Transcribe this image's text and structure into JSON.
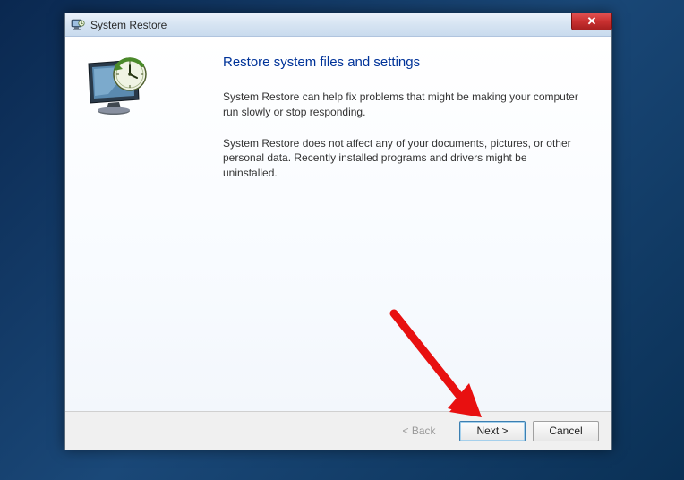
{
  "titlebar": {
    "title": "System Restore",
    "close_symbol": "✕"
  },
  "content": {
    "heading": "Restore system files and settings",
    "paragraph1": "System Restore can help fix problems that might be making your computer run slowly or stop responding.",
    "paragraph2": "System Restore does not affect any of your documents, pictures, or other personal data. Recently installed programs and drivers might be uninstalled."
  },
  "footer": {
    "back_label": "< Back",
    "next_label": "Next >",
    "cancel_label": "Cancel"
  }
}
